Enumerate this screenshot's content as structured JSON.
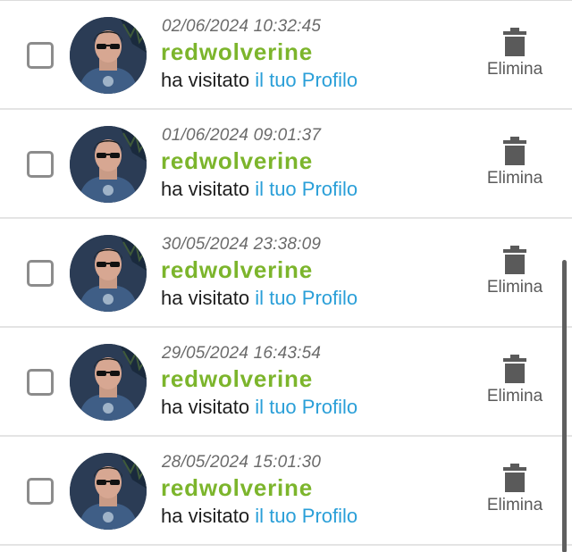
{
  "notifications": [
    {
      "date": "02/06/2024 10:32:45",
      "username": "redwolverine",
      "action_text": "ha visitato",
      "action_link": "il tuo Profilo",
      "delete_label": "Elimina"
    },
    {
      "date": "01/06/2024 09:01:37",
      "username": "redwolverine",
      "action_text": "ha visitato",
      "action_link": "il tuo Profilo",
      "delete_label": "Elimina"
    },
    {
      "date": "30/05/2024 23:38:09",
      "username": "redwolverine",
      "action_text": "ha visitato",
      "action_link": "il tuo Profilo",
      "delete_label": "Elimina"
    },
    {
      "date": "29/05/2024 16:43:54",
      "username": "redwolverine",
      "action_text": "ha visitato",
      "action_link": "il tuo Profilo",
      "delete_label": "Elimina"
    },
    {
      "date": "28/05/2024 15:01:30",
      "username": "redwolverine",
      "action_text": "ha visitato",
      "action_link": "il tuo Profilo",
      "delete_label": "Elimina"
    }
  ],
  "icons": {
    "checkbox": "checkbox-icon",
    "avatar": "avatar",
    "delete": "trash-icon"
  },
  "colors": {
    "username": "#7cb52c",
    "link": "#2a9fd8",
    "date": "#6b6b6b",
    "text": "#1e1e1e",
    "icon": "#5a5a5a",
    "divider": "#e4e4e4"
  }
}
